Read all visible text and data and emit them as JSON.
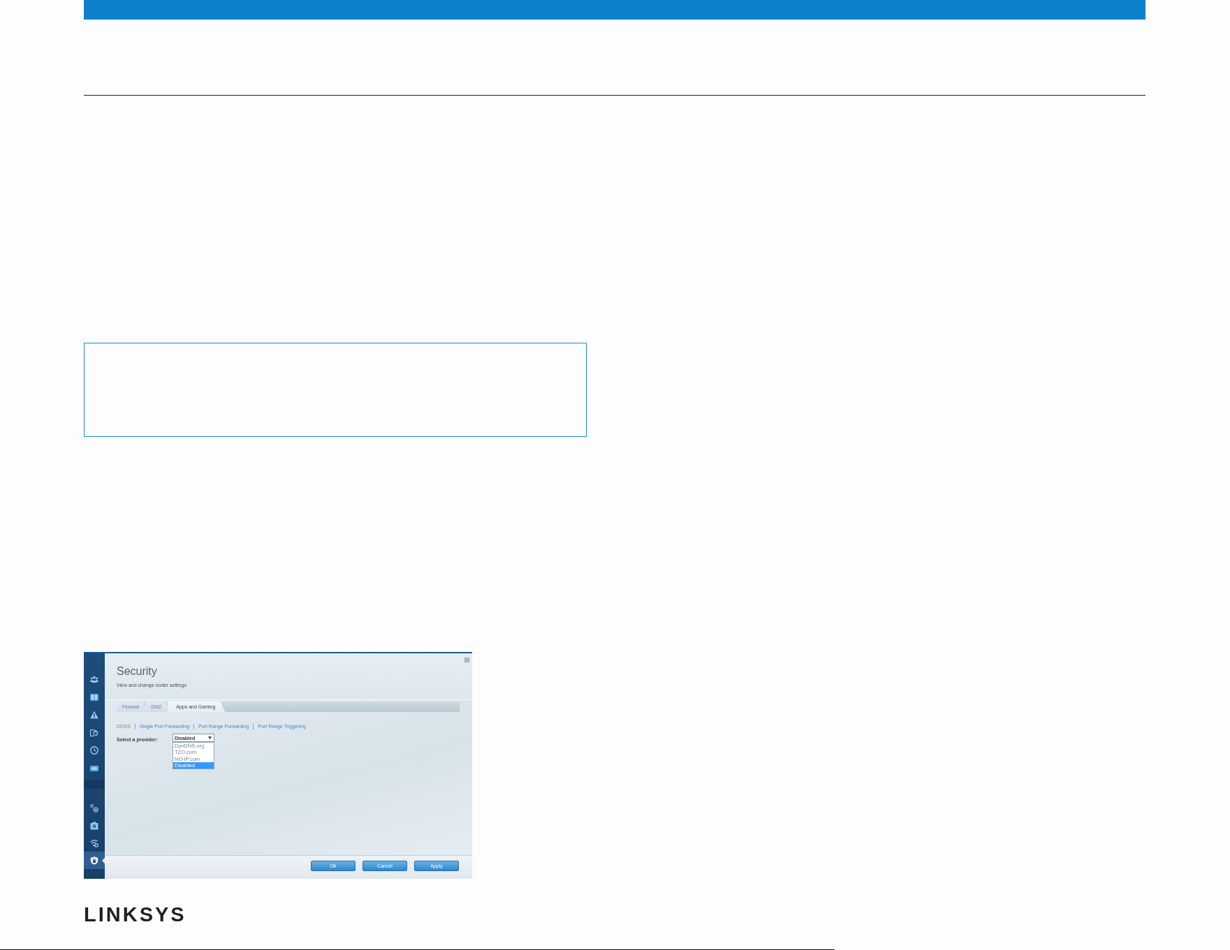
{
  "screenshot": {
    "title": "Security",
    "subtitle": "View and change router settings",
    "sidebar": {
      "groups": [
        {
          "items": [
            {
              "kind": "people",
              "selected": false
            },
            {
              "kind": "grid",
              "selected": false
            },
            {
              "kind": "warning",
              "selected": false
            },
            {
              "kind": "refresh",
              "selected": false
            },
            {
              "kind": "clock",
              "selected": false
            },
            {
              "kind": "port",
              "selected": false
            }
          ]
        },
        {
          "items": [
            {
              "kind": "gears",
              "selected": false
            },
            {
              "kind": "camera",
              "selected": false
            },
            {
              "kind": "wifi",
              "selected": false
            },
            {
              "kind": "shield",
              "selected": true
            }
          ]
        }
      ]
    },
    "tabs": [
      {
        "label": "Firewall",
        "selected": false
      },
      {
        "label": "DMZ",
        "selected": false
      },
      {
        "label": "Apps and Gaming",
        "selected": true
      }
    ],
    "subnav": [
      {
        "label": "DDNS",
        "selected": true
      },
      {
        "label": "Single Port Forwarding",
        "selected": false
      },
      {
        "label": "Port Range Forwarding",
        "selected": false
      },
      {
        "label": "Port Range Triggering",
        "selected": false
      }
    ],
    "provider": {
      "label": "Select a provider:",
      "value": "Disabled",
      "expanded": true,
      "options": [
        {
          "label": "DynDNS.org",
          "selected": false
        },
        {
          "label": "TZO.com",
          "selected": false
        },
        {
          "label": "NO-IP.com",
          "selected": false
        },
        {
          "label": "Disabled",
          "selected": true
        }
      ]
    },
    "buttons": [
      "Ok",
      "Cancel",
      "Apply"
    ]
  },
  "logo": "LINKSYS"
}
